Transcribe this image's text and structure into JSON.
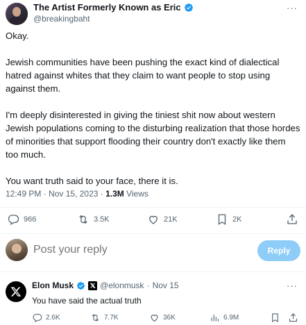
{
  "tweet": {
    "author_name": "The Artist Formerly Known as Eric",
    "author_handle": "@breakingbaht",
    "paragraphs": [
      "Okay.",
      "Jewish communities have been pushing the exact kind of dialectical hatred against whites that they claim to want people to stop using against them.",
      "I'm deeply disinterested in giving the tiniest shit now about western Jewish populations coming to the disturbing realization that those hordes of minorities that support flooding their country don't exactly like them too much.",
      "You want truth said to your face, there it is."
    ],
    "timestamp": "12:49 PM · Nov 15, 2023 · ",
    "views_count": "1.3M",
    "views_label": " Views",
    "stats": {
      "replies": "966",
      "retweets": "3.5K",
      "likes": "21K",
      "bookmarks": "2K"
    }
  },
  "reply_box": {
    "placeholder": "Post your reply",
    "button_label": "Reply"
  },
  "reply": {
    "author_name": "Elon Musk",
    "author_handle": "@elonmusk",
    "separator": "·",
    "date": "Nov 15",
    "text": "You have said the actual truth",
    "stats": {
      "replies": "2.6K",
      "retweets": "7.7K",
      "likes": "36K",
      "views": "6.9M"
    }
  },
  "more_icon_text": "···",
  "colors": {
    "accent": "#1d9bf0",
    "reply_button": "#8ecdf8",
    "muted_text": "#536471",
    "text": "#0f1419"
  },
  "icons": [
    "verified-badge-icon",
    "more-icon",
    "reply-icon",
    "retweet-icon",
    "like-icon",
    "bookmark-icon",
    "share-icon",
    "views-icon",
    "x-logo-icon"
  ]
}
